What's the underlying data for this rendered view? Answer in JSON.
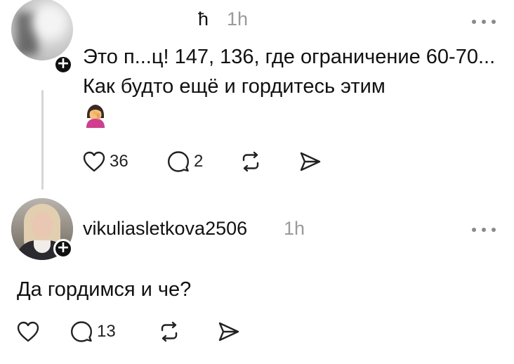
{
  "posts": [
    {
      "username": "ћ",
      "time": "1h",
      "text": "Это п...ц! 147, 136, где ограничение 60-70... Как будто ещё и гордитесь этим",
      "emoji": "woman-facepalming",
      "likes": "36",
      "replies": "2"
    },
    {
      "username": "vikuliasletkova2506",
      "time": "1h",
      "text": "Да гордимся и че?",
      "likes": "",
      "replies": "13"
    }
  ],
  "icons": {
    "like": "heart-icon",
    "reply": "speech-bubble-icon",
    "repost": "repost-icon",
    "share": "send-icon",
    "more": "more-dots-icon",
    "follow": "plus-icon"
  },
  "colors": {
    "text": "#111111",
    "muted": "#9a9a9a",
    "thread_line": "#d6d6d6",
    "badge": "#111111"
  }
}
